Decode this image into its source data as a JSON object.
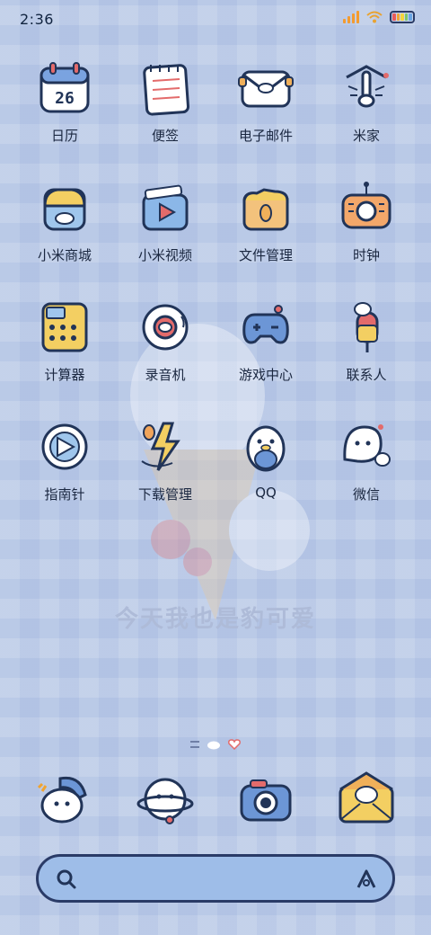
{
  "status": {
    "time": "2:36"
  },
  "apps": [
    {
      "label": "日历"
    },
    {
      "label": "便签"
    },
    {
      "label": "电子邮件"
    },
    {
      "label": "米家"
    },
    {
      "label": "小米商城"
    },
    {
      "label": "小米视频"
    },
    {
      "label": "文件管理"
    },
    {
      "label": "时钟"
    },
    {
      "label": "计算器"
    },
    {
      "label": "录音机"
    },
    {
      "label": "游戏中心"
    },
    {
      "label": "联系人"
    },
    {
      "label": "指南针"
    },
    {
      "label": "下载管理"
    },
    {
      "label": "QQ"
    },
    {
      "label": "微信"
    }
  ],
  "calendar": {
    "date": "26"
  },
  "wallpaper": {
    "text": "今天我也是豹可爱"
  },
  "colors": {
    "accent": "#2a3b67",
    "background": "#b7c7e6"
  }
}
